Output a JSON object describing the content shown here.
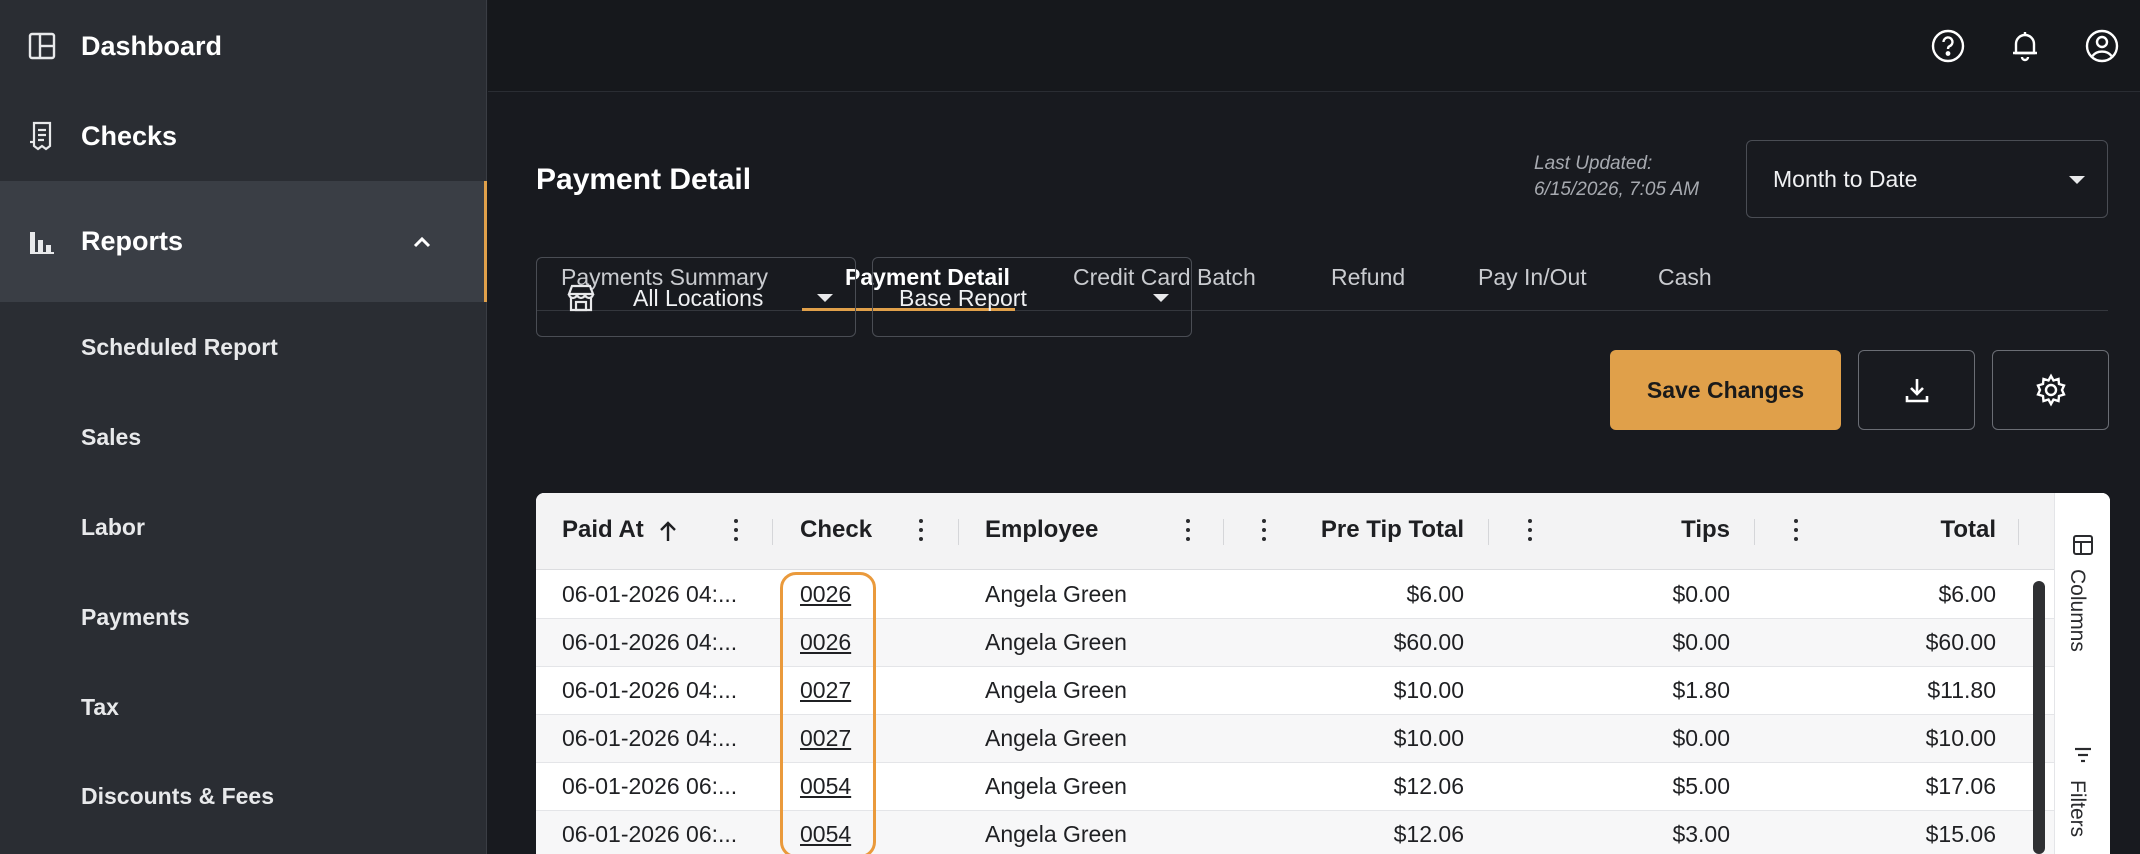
{
  "sidebar": {
    "dashboard_label": "Dashboard",
    "checks_label": "Checks",
    "reports_label": "Reports",
    "sub_items": [
      "Scheduled Report",
      "Sales",
      "Labor",
      "Payments",
      "Tax",
      "Discounts & Fees"
    ]
  },
  "header": {
    "icons": [
      "help-icon",
      "bell-icon",
      "account-icon"
    ]
  },
  "page": {
    "title": "Payment Detail",
    "last_updated_label": "Last Updated:",
    "last_updated_value": "6/15/2026, 7:05 AM",
    "date_range": "Month to Date"
  },
  "tabs": [
    "Payments Summary",
    "Payment Detail",
    "Credit Card Batch",
    "Refund",
    "Pay In/Out",
    "Cash"
  ],
  "filters": {
    "location": "All Locations",
    "report": "Base Report"
  },
  "actions": {
    "save_label": "Save Changes"
  },
  "table": {
    "headers": [
      "Paid At",
      "Check",
      "Employee",
      "Pre Tip Total",
      "Tips",
      "Total"
    ],
    "rows": [
      [
        "06-01-2026 04:...",
        "0026",
        "Angela Green",
        "$6.00",
        "$0.00",
        "$6.00"
      ],
      [
        "06-01-2026 04:...",
        "0026",
        "Angela Green",
        "$60.00",
        "$0.00",
        "$60.00"
      ],
      [
        "06-01-2026 04:...",
        "0027",
        "Angela Green",
        "$10.00",
        "$1.80",
        "$11.80"
      ],
      [
        "06-01-2026 04:...",
        "0027",
        "Angela Green",
        "$10.00",
        "$0.00",
        "$10.00"
      ],
      [
        "06-01-2026 06:...",
        "0054",
        "Angela Green",
        "$12.06",
        "$5.00",
        "$17.06"
      ],
      [
        "06-01-2026 06:...",
        "0054",
        "Angela Green",
        "$12.06",
        "$3.00",
        "$15.06"
      ]
    ],
    "side_panel": [
      "Columns",
      "Filters"
    ]
  },
  "colors": {
    "accent": "#e0a04a",
    "sidebar_bg": "#2a2d33",
    "page_bg": "#181a1f"
  }
}
